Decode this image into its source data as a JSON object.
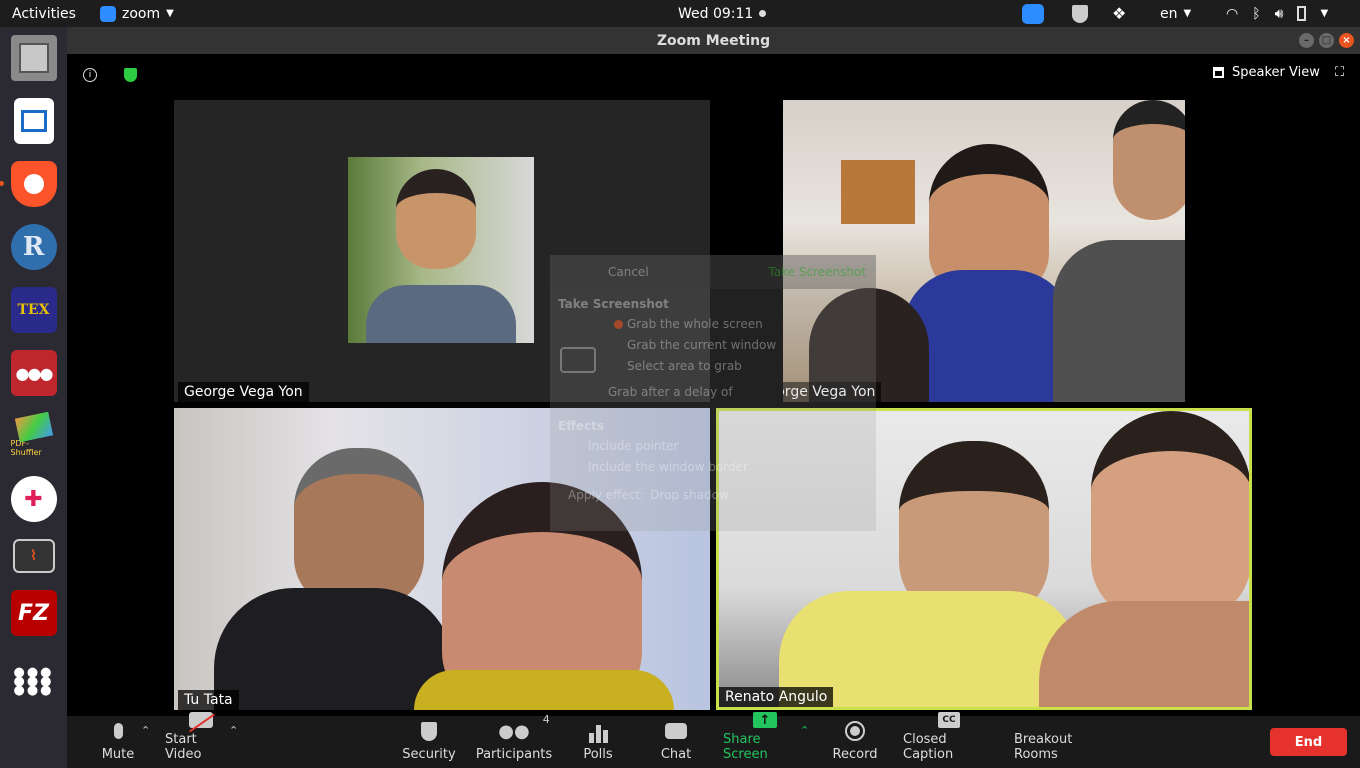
{
  "topbar": {
    "activities": "Activities",
    "app_name": "zoom",
    "clock": "Wed 09:11",
    "language": "en"
  },
  "dock": {
    "items": [
      {
        "name": "files"
      },
      {
        "name": "writer"
      },
      {
        "name": "brave"
      },
      {
        "name": "r",
        "label": "R"
      },
      {
        "name": "texmaker",
        "label": "TEX"
      },
      {
        "name": "mendeley"
      },
      {
        "name": "pdf-shuffler",
        "label": "PDF-Shuffler"
      },
      {
        "name": "slack"
      },
      {
        "name": "system-monitor"
      },
      {
        "name": "filezilla",
        "label": "FZ"
      },
      {
        "name": "app-grid"
      }
    ]
  },
  "window": {
    "title": "Zoom Meeting",
    "view_mode": "Speaker View"
  },
  "participants": [
    {
      "name": "George Vega Yon",
      "muted": false
    },
    {
      "name": "George Vega Yon",
      "muted": true
    },
    {
      "name": "Tu Tata",
      "muted": false
    },
    {
      "name": "Renato Angulo",
      "muted": false,
      "active_speaker": true
    }
  ],
  "screenshot_dialog": {
    "cancel": "Cancel",
    "take": "Take Screenshot",
    "title": "Take Screenshot",
    "options": [
      "Grab the whole screen",
      "Grab the current window",
      "Select area to grab"
    ],
    "delay": "Grab after a delay of",
    "effects": "Effects",
    "include_pointer": "Include pointer",
    "include_border": "Include the window border",
    "apply_effect": "Apply effect:",
    "drop_shadow": "Drop shadow"
  },
  "toolbar": {
    "mute": "Mute",
    "start_video": "Start Video",
    "security": "Security",
    "participants": "Participants",
    "participants_count": "4",
    "polls": "Polls",
    "chat": "Chat",
    "share_screen": "Share Screen",
    "record": "Record",
    "closed_caption": "Closed Caption",
    "cc_label": "CC",
    "breakout_rooms": "Breakout Rooms",
    "end": "End"
  },
  "colors": {
    "share_green": "#22c55e",
    "end_red": "#e5322d",
    "active_speaker_border": "#c9e04a",
    "secure_shield": "#2ecc40"
  }
}
